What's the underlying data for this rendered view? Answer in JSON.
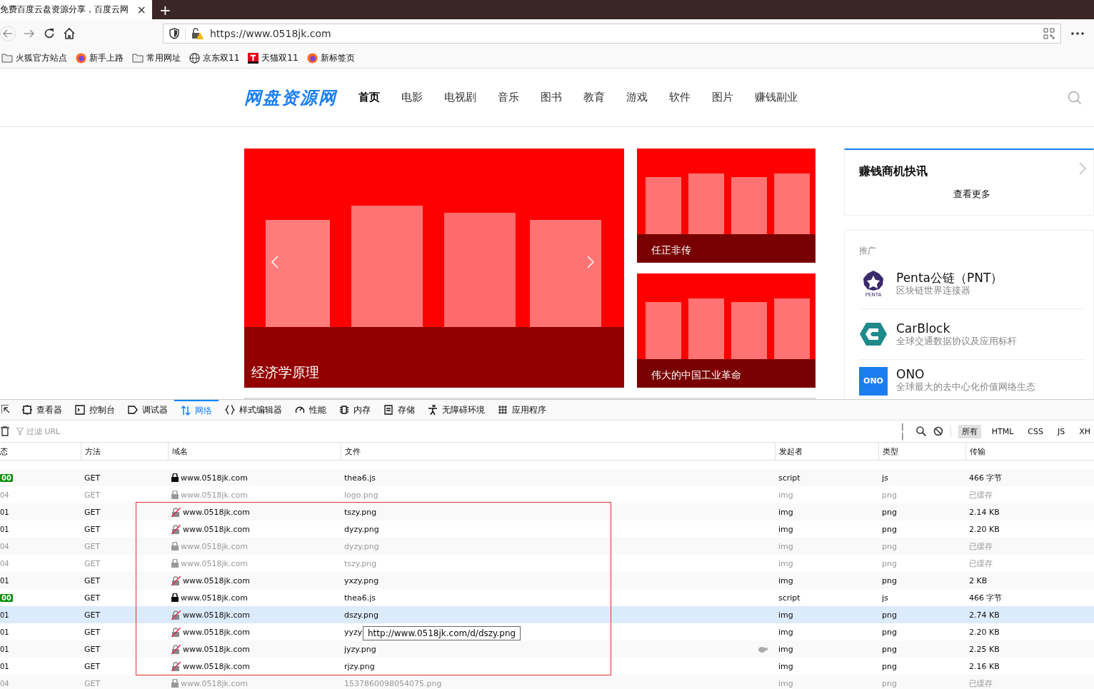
{
  "browser": {
    "tab_title": "免费百度云盘资源分享，百度云网",
    "tab_close": "×",
    "new_tab": "+",
    "url": "https://www.0518jk.com",
    "bookmarks": [
      {
        "label": "火狐官方站点",
        "kind": "folder"
      },
      {
        "label": "新手上路",
        "kind": "firefox"
      },
      {
        "label": "常用网址",
        "kind": "folder"
      },
      {
        "label": "京东双11",
        "kind": "globe"
      },
      {
        "label": "天猫双11",
        "kind": "tmall"
      },
      {
        "label": "新标签页",
        "kind": "firefox"
      }
    ]
  },
  "site": {
    "logo": "网盘资源网",
    "nav": [
      {
        "label": "首页",
        "selected": true
      },
      {
        "label": "电影",
        "selected": false
      },
      {
        "label": "电视剧",
        "selected": false
      },
      {
        "label": "音乐",
        "selected": false
      },
      {
        "label": "图书",
        "selected": false
      },
      {
        "label": "教育",
        "selected": false
      },
      {
        "label": "游戏",
        "selected": false
      },
      {
        "label": "软件",
        "selected": false
      },
      {
        "label": "图片",
        "selected": false
      },
      {
        "label": "赚钱副业",
        "selected": false
      }
    ],
    "slider": {
      "caption": "经济学原理"
    },
    "side_banners": [
      {
        "caption": "任正非传"
      },
      {
        "caption": "伟大的中国工业革命"
      }
    ],
    "news": {
      "title": "赚钱商机快讯",
      "more": "查看更多"
    },
    "promo": {
      "title": "推广",
      "items": [
        {
          "name": "Penta公链（PNT）",
          "desc": "区块链世界连接器",
          "kind": "penta",
          "logo_text": "PENTA"
        },
        {
          "name": "CarBlock",
          "desc": "全球交通数据协议及应用标杆",
          "kind": "carblock"
        },
        {
          "name": "ONO",
          "desc": "全球最大的去中心化价值网络生态",
          "kind": "ono",
          "logo_text": "ONO"
        }
      ]
    }
  },
  "devtools": {
    "tools": [
      {
        "label": "查看器",
        "kind": "inspector",
        "selected": false
      },
      {
        "label": "控制台",
        "kind": "console",
        "selected": false
      },
      {
        "label": "调试器",
        "kind": "debugger",
        "selected": false
      },
      {
        "label": "网络",
        "kind": "network",
        "selected": true
      },
      {
        "label": "样式编辑器",
        "kind": "style",
        "selected": false
      },
      {
        "label": "性能",
        "kind": "perf",
        "selected": false
      },
      {
        "label": "内存",
        "kind": "memory",
        "selected": false
      },
      {
        "label": "存储",
        "kind": "storage",
        "selected": false
      },
      {
        "label": "无障碍环境",
        "kind": "a11y",
        "selected": false
      },
      {
        "label": "应用程序",
        "kind": "app",
        "selected": false
      }
    ],
    "filter_placeholder": "过滤 URL",
    "pause": "| |",
    "types": [
      {
        "label": "所有",
        "selected": true
      },
      {
        "label": "HTML",
        "selected": false
      },
      {
        "label": "CSS",
        "selected": false
      },
      {
        "label": "JS",
        "selected": false
      },
      {
        "label": "XH",
        "selected": false
      }
    ],
    "columns": [
      "态",
      "方法",
      "域名",
      "文件",
      "发起者",
      "类型",
      "传输"
    ],
    "rows": [
      {
        "status": "00",
        "ok": true,
        "method": "GET",
        "domain": "www.0518jk.com",
        "secure": true,
        "file": "thea6.js",
        "initiator": "script",
        "type": "js",
        "transfer": "466 字节",
        "cached": false,
        "selected": false,
        "slow": false
      },
      {
        "status": "04",
        "ok": false,
        "method": "GET",
        "domain": "www.0518jk.com",
        "secure": true,
        "file": "logo.png",
        "initiator": "img",
        "type": "png",
        "transfer": "已缓存",
        "cached": true,
        "selected": false,
        "slow": false
      },
      {
        "status": "01",
        "ok": false,
        "method": "GET",
        "domain": "www.0518jk.com",
        "secure": false,
        "file": "tszy.png",
        "initiator": "img",
        "type": "png",
        "transfer": "2.14 KB",
        "cached": false,
        "selected": false,
        "slow": false
      },
      {
        "status": "01",
        "ok": false,
        "method": "GET",
        "domain": "www.0518jk.com",
        "secure": false,
        "file": "dyzy.png",
        "initiator": "img",
        "type": "png",
        "transfer": "2.20 KB",
        "cached": false,
        "selected": false,
        "slow": false
      },
      {
        "status": "04",
        "ok": false,
        "method": "GET",
        "domain": "www.0518jk.com",
        "secure": true,
        "file": "dyzy.png",
        "initiator": "img",
        "type": "png",
        "transfer": "已缓存",
        "cached": true,
        "selected": false,
        "slow": false
      },
      {
        "status": "04",
        "ok": false,
        "method": "GET",
        "domain": "www.0518jk.com",
        "secure": true,
        "file": "tszy.png",
        "initiator": "img",
        "type": "png",
        "transfer": "已缓存",
        "cached": true,
        "selected": false,
        "slow": false
      },
      {
        "status": "01",
        "ok": false,
        "method": "GET",
        "domain": "www.0518jk.com",
        "secure": false,
        "file": "yxzy.png",
        "initiator": "img",
        "type": "png",
        "transfer": "2 KB",
        "cached": false,
        "selected": false,
        "slow": false
      },
      {
        "status": "00",
        "ok": true,
        "method": "GET",
        "domain": "www.0518jk.com",
        "secure": true,
        "file": "thea6.js",
        "initiator": "script",
        "type": "js",
        "transfer": "466 字节",
        "cached": false,
        "selected": false,
        "slow": false
      },
      {
        "status": "01",
        "ok": false,
        "method": "GET",
        "domain": "www.0518jk.com",
        "secure": false,
        "file": "dszy.png",
        "initiator": "img",
        "type": "png",
        "transfer": "2.74 KB",
        "cached": false,
        "selected": true,
        "slow": false
      },
      {
        "status": "01",
        "ok": false,
        "method": "GET",
        "domain": "www.0518jk.com",
        "secure": false,
        "file": "yyzy",
        "initiator": "img",
        "type": "png",
        "transfer": "2.20 KB",
        "cached": false,
        "selected": false,
        "slow": false,
        "tooltip": "http://www.0518jk.com/d/dszy.png"
      },
      {
        "status": "01",
        "ok": false,
        "method": "GET",
        "domain": "www.0518jk.com",
        "secure": false,
        "file": "jyzy.png",
        "initiator": "img",
        "type": "png",
        "transfer": "2.25 KB",
        "cached": false,
        "selected": false,
        "slow": true
      },
      {
        "status": "01",
        "ok": false,
        "method": "GET",
        "domain": "www.0518jk.com",
        "secure": false,
        "file": "rjzy.png",
        "initiator": "img",
        "type": "png",
        "transfer": "2.16 KB",
        "cached": false,
        "selected": false,
        "slow": false
      },
      {
        "status": "04",
        "ok": false,
        "method": "GET",
        "domain": "www.0518jk.com",
        "secure": true,
        "file": "1537860098054075.png",
        "initiator": "img",
        "type": "png",
        "transfer": "已缓存",
        "cached": true,
        "selected": false,
        "slow": false
      }
    ]
  }
}
